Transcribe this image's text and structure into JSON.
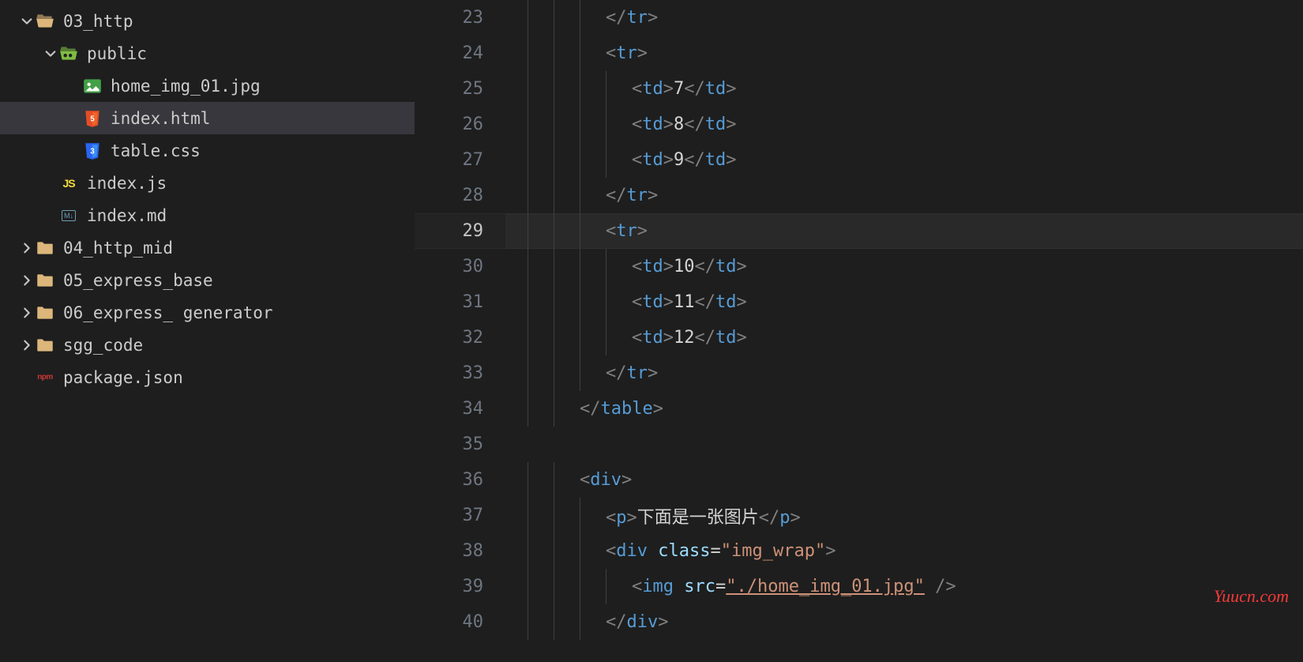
{
  "sidebar": {
    "items": [
      {
        "name": "03_http",
        "type": "folder-open",
        "depth": 0,
        "expanded": true,
        "chev": "down"
      },
      {
        "name": "public",
        "type": "folder-public",
        "depth": 1,
        "expanded": true,
        "chev": "down"
      },
      {
        "name": "home_img_01.jpg",
        "type": "image",
        "depth": 2
      },
      {
        "name": "index.html",
        "type": "html",
        "depth": 2,
        "selected": true
      },
      {
        "name": "table.css",
        "type": "css",
        "depth": 2
      },
      {
        "name": "index.js",
        "type": "js",
        "depth": 1
      },
      {
        "name": "index.md",
        "type": "md",
        "depth": 1
      },
      {
        "name": "04_http_mid",
        "type": "folder",
        "depth": 0,
        "chev": "right"
      },
      {
        "name": "05_express_base",
        "type": "folder",
        "depth": 0,
        "chev": "right"
      },
      {
        "name": "06_express_ generator",
        "type": "folder",
        "depth": 0,
        "chev": "right"
      },
      {
        "name": "sgg_code",
        "type": "folder",
        "depth": 0,
        "chev": "right"
      },
      {
        "name": "package.json",
        "type": "npm",
        "depth": 0
      }
    ]
  },
  "editor": {
    "active_line": 29,
    "lines": [
      {
        "n": 23,
        "indent": 3,
        "tokens": [
          [
            "br",
            "</"
          ],
          [
            "tag",
            "tr"
          ],
          [
            "br",
            ">"
          ]
        ]
      },
      {
        "n": 24,
        "indent": 3,
        "tokens": [
          [
            "br",
            "<"
          ],
          [
            "tag",
            "tr"
          ],
          [
            "br",
            ">"
          ]
        ]
      },
      {
        "n": 25,
        "indent": 4,
        "tokens": [
          [
            "br",
            "<"
          ],
          [
            "tag",
            "td"
          ],
          [
            "br",
            ">"
          ],
          [
            "txt",
            "7"
          ],
          [
            "br",
            "</"
          ],
          [
            "tag",
            "td"
          ],
          [
            "br",
            ">"
          ]
        ]
      },
      {
        "n": 26,
        "indent": 4,
        "tokens": [
          [
            "br",
            "<"
          ],
          [
            "tag",
            "td"
          ],
          [
            "br",
            ">"
          ],
          [
            "txt",
            "8"
          ],
          [
            "br",
            "</"
          ],
          [
            "tag",
            "td"
          ],
          [
            "br",
            ">"
          ]
        ]
      },
      {
        "n": 27,
        "indent": 4,
        "tokens": [
          [
            "br",
            "<"
          ],
          [
            "tag",
            "td"
          ],
          [
            "br",
            ">"
          ],
          [
            "txt",
            "9"
          ],
          [
            "br",
            "</"
          ],
          [
            "tag",
            "td"
          ],
          [
            "br",
            ">"
          ]
        ]
      },
      {
        "n": 28,
        "indent": 3,
        "tokens": [
          [
            "br",
            "</"
          ],
          [
            "tag",
            "tr"
          ],
          [
            "br",
            ">"
          ]
        ]
      },
      {
        "n": 29,
        "indent": 3,
        "tokens": [
          [
            "br",
            "<"
          ],
          [
            "tag",
            "tr"
          ],
          [
            "br",
            ">"
          ]
        ]
      },
      {
        "n": 30,
        "indent": 4,
        "tokens": [
          [
            "br",
            "<"
          ],
          [
            "tag",
            "td"
          ],
          [
            "br",
            ">"
          ],
          [
            "txt",
            "10"
          ],
          [
            "br",
            "</"
          ],
          [
            "tag",
            "td"
          ],
          [
            "br",
            ">"
          ]
        ]
      },
      {
        "n": 31,
        "indent": 4,
        "tokens": [
          [
            "br",
            "<"
          ],
          [
            "tag",
            "td"
          ],
          [
            "br",
            ">"
          ],
          [
            "txt",
            "11"
          ],
          [
            "br",
            "</"
          ],
          [
            "tag",
            "td"
          ],
          [
            "br",
            ">"
          ]
        ]
      },
      {
        "n": 32,
        "indent": 4,
        "tokens": [
          [
            "br",
            "<"
          ],
          [
            "tag",
            "td"
          ],
          [
            "br",
            ">"
          ],
          [
            "txt",
            "12"
          ],
          [
            "br",
            "</"
          ],
          [
            "tag",
            "td"
          ],
          [
            "br",
            ">"
          ]
        ]
      },
      {
        "n": 33,
        "indent": 3,
        "tokens": [
          [
            "br",
            "</"
          ],
          [
            "tag",
            "tr"
          ],
          [
            "br",
            ">"
          ]
        ]
      },
      {
        "n": 34,
        "indent": 2,
        "tokens": [
          [
            "br",
            "</"
          ],
          [
            "tag",
            "table"
          ],
          [
            "br",
            ">"
          ]
        ]
      },
      {
        "n": 35,
        "indent": 0,
        "tokens": []
      },
      {
        "n": 36,
        "indent": 2,
        "tokens": [
          [
            "br",
            "<"
          ],
          [
            "tag",
            "div"
          ],
          [
            "br",
            ">"
          ]
        ]
      },
      {
        "n": 37,
        "indent": 3,
        "tokens": [
          [
            "br",
            "<"
          ],
          [
            "tag",
            "p"
          ],
          [
            "br",
            ">"
          ],
          [
            "txt",
            "下面是一张图片"
          ],
          [
            "br",
            "</"
          ],
          [
            "tag",
            "p"
          ],
          [
            "br",
            ">"
          ]
        ]
      },
      {
        "n": 38,
        "indent": 3,
        "tokens": [
          [
            "br",
            "<"
          ],
          [
            "tag",
            "div"
          ],
          [
            "txt",
            " "
          ],
          [
            "attr",
            "class"
          ],
          [
            "txt",
            "="
          ],
          [
            "str",
            "\"img_wrap\""
          ],
          [
            "br",
            ">"
          ]
        ]
      },
      {
        "n": 39,
        "indent": 4,
        "tokens": [
          [
            "br",
            "<"
          ],
          [
            "tag",
            "img"
          ],
          [
            "txt",
            " "
          ],
          [
            "attr",
            "src"
          ],
          [
            "txt",
            "="
          ],
          [
            "stru",
            "\"./home_img_01.jpg\""
          ],
          [
            "txt",
            " "
          ],
          [
            "br",
            "/>"
          ]
        ]
      },
      {
        "n": 40,
        "indent": 3,
        "tokens": [
          [
            "br",
            "</"
          ],
          [
            "tag",
            "div"
          ],
          [
            "br",
            ">"
          ]
        ]
      }
    ]
  },
  "watermark": "Yuucn.com"
}
